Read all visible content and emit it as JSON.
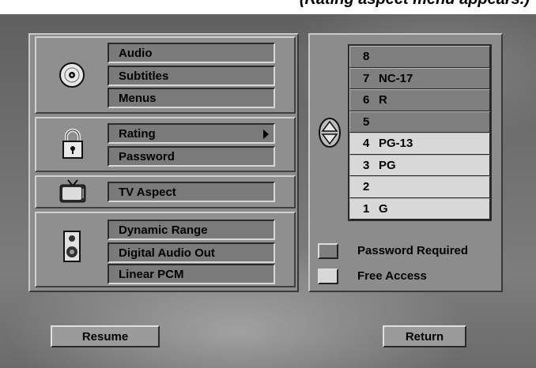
{
  "caption": "(Rating aspect menu appears.)",
  "left_menu": {
    "group_disc": [
      "Audio",
      "Subtitles",
      "Menus"
    ],
    "group_lock": [
      "Rating",
      "Password"
    ],
    "group_tv": [
      "TV Aspect"
    ],
    "group_speaker": [
      "Dynamic Range",
      "Digital Audio Out",
      "Linear PCM"
    ]
  },
  "rating_list": [
    {
      "num": "8",
      "label": "",
      "state": "locked"
    },
    {
      "num": "7",
      "label": "NC-17",
      "state": "locked"
    },
    {
      "num": "6",
      "label": "R",
      "state": "locked"
    },
    {
      "num": "5",
      "label": "",
      "state": "locked"
    },
    {
      "num": "4",
      "label": "PG-13",
      "state": "free"
    },
    {
      "num": "3",
      "label": "PG",
      "state": "free"
    },
    {
      "num": "2",
      "label": "",
      "state": "free"
    },
    {
      "num": "1",
      "label": "G",
      "state": "free"
    }
  ],
  "legend": {
    "locked_label": "Password Required",
    "free_label": "Free Access"
  },
  "buttons": {
    "resume": "Resume",
    "return": "Return"
  },
  "colors": {
    "locked": "#7f7f7f",
    "free": "#d8d8d8"
  }
}
